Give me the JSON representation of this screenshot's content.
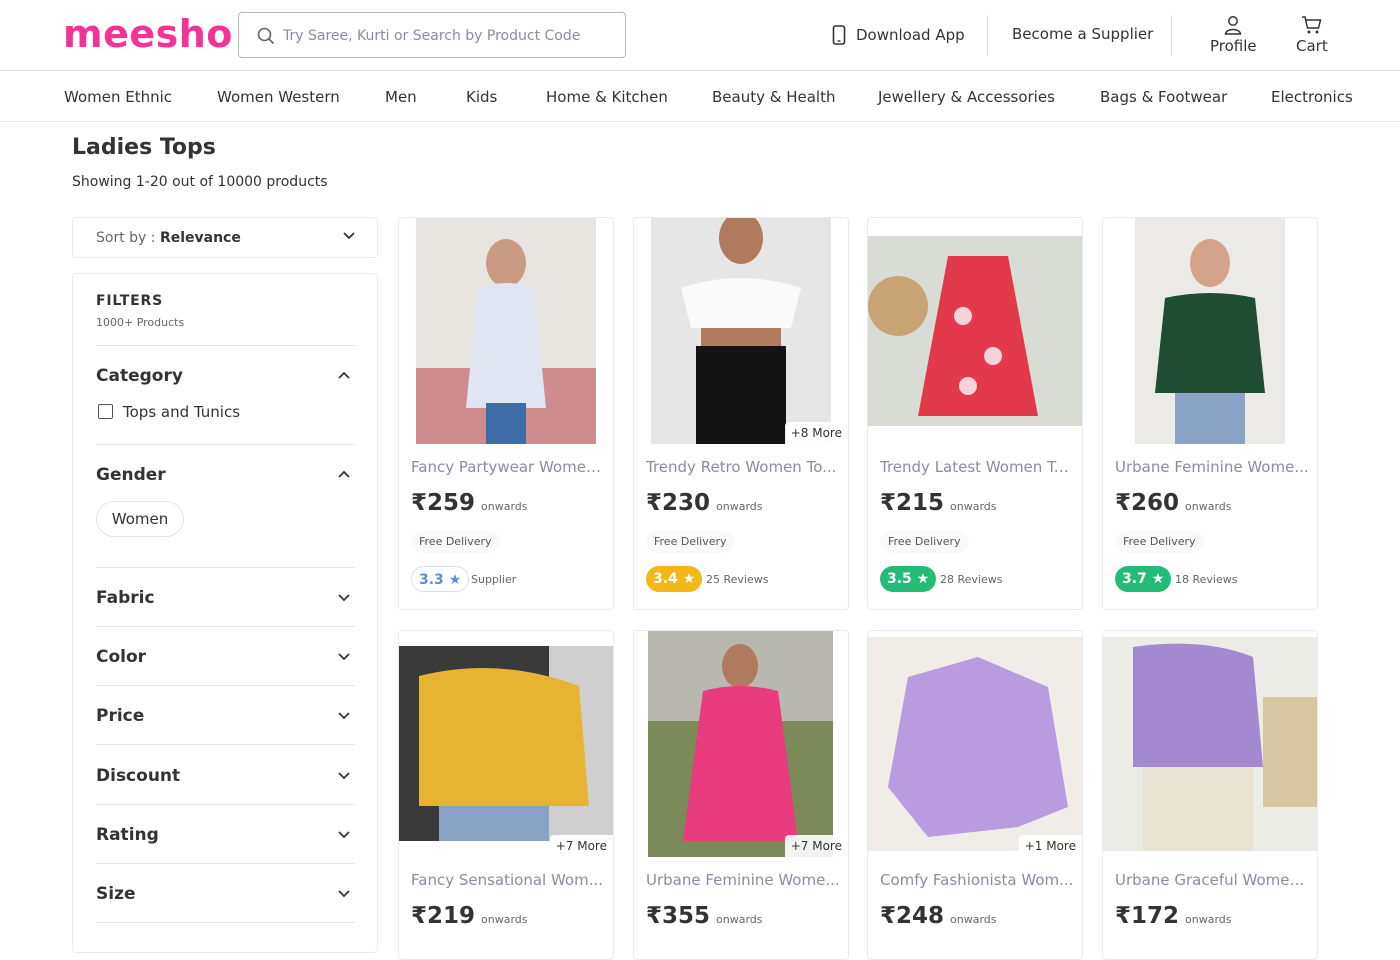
{
  "header": {
    "logo": "meesho",
    "search_placeholder": "Try Saree, Kurti or Search by Product Code",
    "download_app": "Download App",
    "become_supplier": "Become a Supplier",
    "profile": "Profile",
    "cart": "Cart"
  },
  "nav": [
    "Women Ethnic",
    "Women Western",
    "Men",
    "Kids",
    "Home & Kitchen",
    "Beauty & Health",
    "Jewellery & Accessories",
    "Bags & Footwear",
    "Electronics"
  ],
  "page": {
    "title": "Ladies Tops",
    "showing_prefix": "Showing 1-20 out of 10000 products"
  },
  "sort": {
    "label": "Sort by : ",
    "value": "Relevance"
  },
  "filters": {
    "title": "FILTERS",
    "count": "1000+ Products",
    "sections": [
      "Category",
      "Gender",
      "Fabric",
      "Color",
      "Price",
      "Discount",
      "Rating",
      "Size"
    ],
    "category_option": "Tops and Tunics",
    "gender_option": "Women"
  },
  "products": [
    {
      "name": "Fancy Partywear Women...",
      "price": "₹259",
      "onwards": "onwards",
      "free": "Free Delivery",
      "rating": "3.3",
      "reviews": "Supplier",
      "more": "",
      "color": "blue"
    },
    {
      "name": "Trendy Retro Women To...",
      "price": "₹230",
      "onwards": "onwards",
      "free": "Free Delivery",
      "rating": "3.4",
      "reviews": "25 Reviews",
      "more": "+8 More",
      "color": "#f4b619"
    },
    {
      "name": "Trendy Latest Women To...",
      "price": "₹215",
      "onwards": "onwards",
      "free": "Free Delivery",
      "rating": "3.5",
      "reviews": "28 Reviews",
      "more": "",
      "color": "#23bb75"
    },
    {
      "name": "Urbane Feminine Wome...",
      "price": "₹260",
      "onwards": "onwards",
      "free": "Free Delivery",
      "rating": "3.7",
      "reviews": "18 Reviews",
      "more": "",
      "color": "#23bb75"
    },
    {
      "name": "Fancy Sensational Wom...",
      "price": "₹219",
      "onwards": "onwards",
      "more": "+7 More"
    },
    {
      "name": "Urbane Feminine Wome...",
      "price": "₹355",
      "onwards": "onwards",
      "more": "+7 More"
    },
    {
      "name": "Comfy Fashionista Wom...",
      "price": "₹248",
      "onwards": "onwards",
      "more": "+1 More"
    },
    {
      "name": "Urbane Graceful Women...",
      "price": "₹172",
      "onwards": "onwards",
      "more": ""
    }
  ],
  "colors": {
    "brand": "#f43397",
    "rating_green": "#23bb75",
    "rating_yellow": "#f4b619"
  },
  "icons": [
    "search-icon",
    "mobile-icon",
    "profile-icon",
    "cart-icon",
    "chevron-down-icon",
    "chevron-up-icon",
    "star-icon"
  ]
}
